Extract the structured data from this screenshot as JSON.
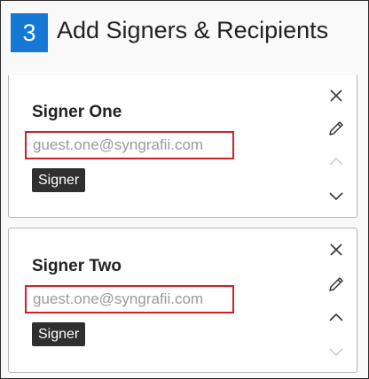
{
  "header": {
    "step_number": "3",
    "title": "Add Signers & Recipients",
    "accent_color": "#1478d4"
  },
  "signers": [
    {
      "name": "Signer One",
      "email": "guest.one@syngrafii.com",
      "role": "Signer",
      "actions": {
        "remove": "close-icon",
        "edit": "pencil-icon",
        "move_up": "chevron-up-icon",
        "move_up_enabled": false,
        "move_down": "chevron-down-icon",
        "move_down_enabled": true
      }
    },
    {
      "name": "Signer Two",
      "email": "guest.one@syngrafii.com",
      "role": "Signer",
      "actions": {
        "remove": "close-icon",
        "edit": "pencil-icon",
        "move_up": "chevron-up-icon",
        "move_up_enabled": true,
        "move_down": "chevron-down-icon",
        "move_down_enabled": false
      }
    }
  ],
  "colors": {
    "highlight_border": "#d0202a",
    "role_badge_bg": "#2f2f2f",
    "icon_active": "#333333",
    "icon_disabled": "#cfcfcf"
  }
}
